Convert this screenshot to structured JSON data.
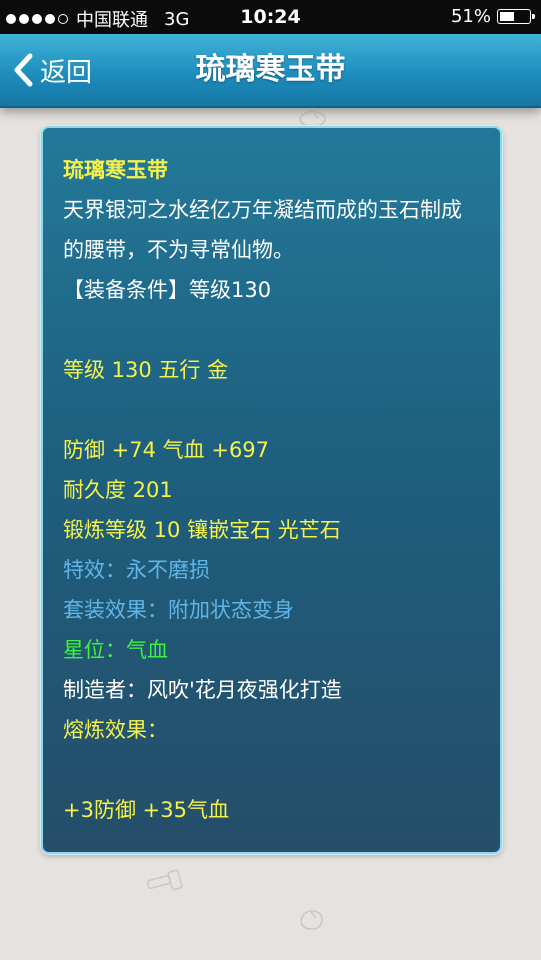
{
  "status_bar": {
    "carrier": "中国联通",
    "network": "3G",
    "time": "10:24",
    "battery": "51%",
    "battery_level": 0.51,
    "signal_bars_filled": 4,
    "signal_bars_total": 5
  },
  "nav": {
    "back_label": "返回",
    "title": "琉璃寒玉带"
  },
  "item": {
    "name": "琉璃寒玉带",
    "description": "天界银河之水经亿万年凝结而成的玉石制成的腰带，不为寻常仙物。",
    "requirement": "【装备条件】等级130",
    "level_element": "等级 130 五行 金",
    "defense_hp": "防御 +74 气血 +697",
    "durability": "耐久度 201",
    "forge_gem": "锻炼等级 10 镶嵌宝石 光芒石",
    "special_effect": "特效：永不磨损",
    "set_effect": "套装效果：附加状态变身",
    "star": "星位：气血",
    "maker": "制造者：风吹'花月夜强化打造",
    "smelt_label": "熔炼效果：",
    "smelt_value": "+3防御 +35气血"
  },
  "colors": {
    "yellow": "#f5f24a",
    "white": "#ffffff",
    "light_blue": "#5fb6e6",
    "green": "#3df23d",
    "nav_blue": "#1e8dbd",
    "panel_border": "#8fd7ea"
  }
}
